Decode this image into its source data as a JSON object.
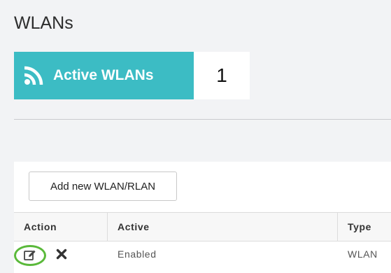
{
  "page": {
    "title": "WLANs"
  },
  "summary_tile": {
    "label": "Active WLANs",
    "count": "1",
    "icon": "wifi-signal-icon",
    "color": "#3cbcc4"
  },
  "toolbar": {
    "add_label": "Add new WLAN/RLAN"
  },
  "table": {
    "columns": [
      "Action",
      "Active",
      "Type"
    ],
    "rows": [
      {
        "actions": [
          "edit-icon",
          "delete-icon"
        ],
        "active": "Enabled",
        "type": "WLAN"
      }
    ]
  },
  "highlight": {
    "color": "#5ab93a"
  }
}
